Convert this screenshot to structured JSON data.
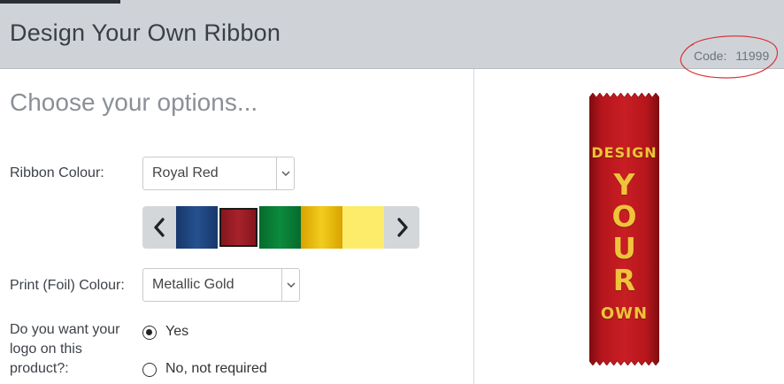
{
  "header": {
    "title": "Design Your Own Ribbon",
    "code_label": "Code:",
    "code_value": "11999"
  },
  "options": {
    "heading": "Choose your options...",
    "ribbon_colour": {
      "label": "Ribbon Colour:",
      "selected": "Royal Red"
    },
    "swatches": [
      {
        "name": "Royal Blue",
        "color": "#1c3f78",
        "selected": false
      },
      {
        "name": "Royal Red",
        "color": "#8e1b22",
        "selected": true
      },
      {
        "name": "Green",
        "color": "#0a7a35",
        "selected": false
      },
      {
        "name": "Gold",
        "color": "#e8bb14",
        "selected": false
      },
      {
        "name": "Yellow",
        "color": "#fdec6a",
        "selected": false
      }
    ],
    "print_colour": {
      "label": "Print (Foil) Colour:",
      "selected": "Metallic Gold"
    },
    "logo": {
      "label_line1": "Do you want your",
      "label_line2": "logo on this",
      "label_line3": "product?:",
      "option_yes": "Yes",
      "option_no": "No, not required",
      "selected": "Yes"
    }
  },
  "preview": {
    "line1": "DESIGN",
    "line2": [
      "Y",
      "O",
      "U",
      "R"
    ],
    "line3": "OWN",
    "ribbon_color": "#b5161c",
    "text_color": "#f0c43a"
  }
}
